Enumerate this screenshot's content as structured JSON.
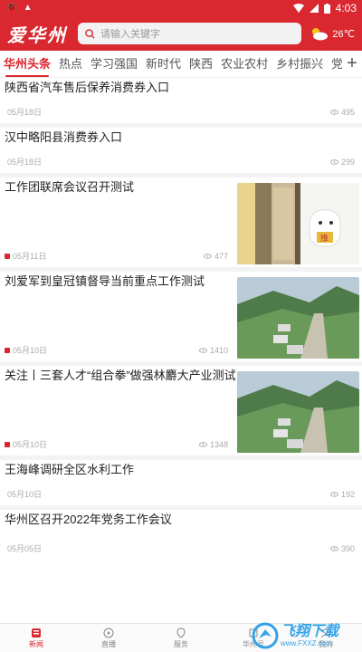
{
  "status_bar": {
    "time": "4:03"
  },
  "header": {
    "logo": "爱华州",
    "search_placeholder": "请输入关键字",
    "weather_temp": "26℃"
  },
  "tabs": [
    {
      "label": "华州头条",
      "active": true
    },
    {
      "label": "热点"
    },
    {
      "label": "学习强国"
    },
    {
      "label": "新时代"
    },
    {
      "label": "陕西"
    },
    {
      "label": "农业农村"
    },
    {
      "label": "乡村振兴"
    },
    {
      "label": "党的二十大"
    }
  ],
  "tab_add": "+",
  "news": [
    {
      "title": "陕西省汽车售后保养消费券入口",
      "date": "05月18日",
      "views": "495"
    },
    {
      "title": "汉中略阳县消费券入口",
      "date": "05月18日",
      "views": "299"
    },
    {
      "title": "工作团联席会议召开测试",
      "date": "05月11日",
      "views": "477"
    },
    {
      "title": "刘爱军到皇冠镇督导当前重点工作测试",
      "date": "05月10日",
      "views": "1410"
    },
    {
      "title": "关注丨三套人才“组合拳”做强林麝大产业测试",
      "date": "05月10日",
      "views": "1348"
    },
    {
      "title": "王海峰调研全区水利工作",
      "date": "05月10日",
      "views": "192"
    },
    {
      "title": "华州区召开2022年党务工作会议",
      "date": "05月05日",
      "views": "390"
    }
  ],
  "thumb_sign_text": "推",
  "bottom_nav": [
    {
      "label": "新闻",
      "icon": "news-icon",
      "active": true
    },
    {
      "label": "直播",
      "icon": "play-icon"
    },
    {
      "label": "服务",
      "icon": "service-icon"
    },
    {
      "label": "华州号",
      "icon": "account-icon"
    },
    {
      "label": "我的",
      "icon": "user-icon"
    }
  ],
  "watermark": {
    "text": "飞翔下载",
    "sub": "www.FXXZ.com"
  },
  "colors": {
    "brand": "#d9282f",
    "watermark": "#35a3e8"
  }
}
